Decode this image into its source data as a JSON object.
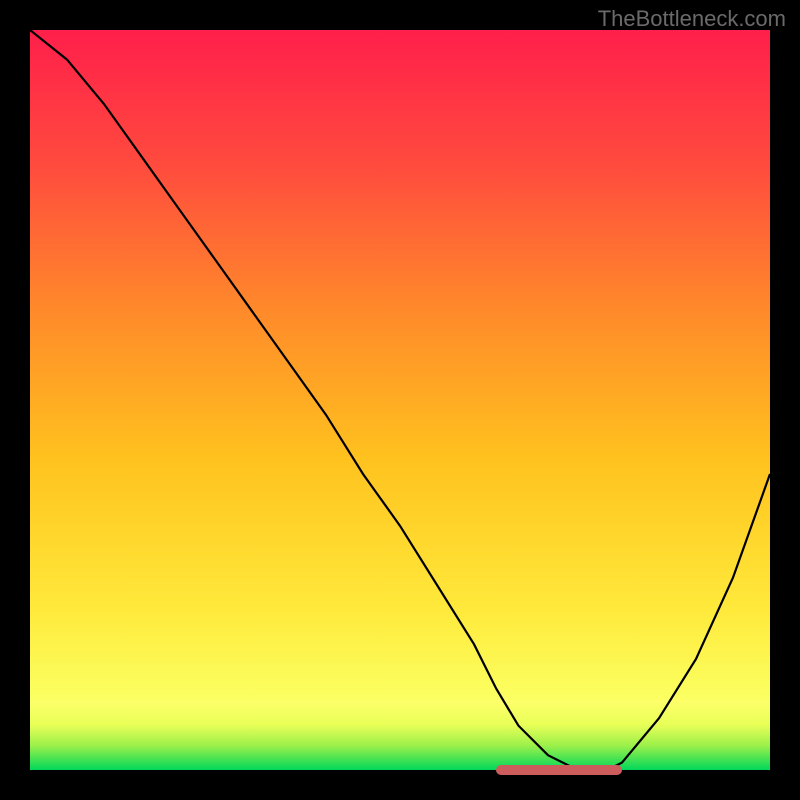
{
  "watermark": "TheBottleneck.com",
  "chart_data": {
    "type": "line",
    "title": "",
    "xlabel": "",
    "ylabel": "",
    "xlim": [
      0,
      100
    ],
    "ylim": [
      0,
      100
    ],
    "x": [
      0,
      5,
      10,
      15,
      20,
      25,
      30,
      35,
      40,
      45,
      50,
      55,
      60,
      63,
      66,
      70,
      74,
      78,
      80,
      85,
      90,
      95,
      100
    ],
    "values": [
      100,
      96,
      90,
      83,
      76,
      69,
      62,
      55,
      48,
      40,
      33,
      25,
      17,
      11,
      6,
      2,
      0,
      0,
      1,
      7,
      15,
      26,
      40
    ],
    "background_gradient": {
      "top": "#ff1f4b",
      "mid": "#ffd400",
      "bottom_band_top": "#ffff6a",
      "bottom_band_bottom": "#00e060"
    },
    "flat_region": {
      "x_start": 63,
      "x_end": 80,
      "color": "#cd5c5c"
    },
    "annotations": []
  }
}
